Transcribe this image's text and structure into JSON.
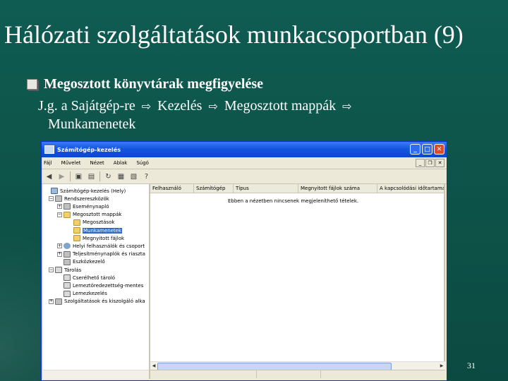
{
  "slide": {
    "title": "Hálózati szolgáltatások munkacsoportban (9)",
    "bullet": "Megosztott könyvtárak megfigyelése",
    "line1": "J.g. a Sajátgép-re",
    "path1": "Kezelés",
    "path2": "Megosztott mappák",
    "line2": "Munkamenetek",
    "arrow_glyph": "⇨",
    "page_number": "31"
  },
  "window": {
    "title": "Számítógép-kezelés",
    "menu": [
      "Fájl",
      "Művelet",
      "Nézet",
      "Ablak",
      "Súgó"
    ],
    "buttons": {
      "minimize": "_",
      "maximize": "□",
      "close": "✕"
    },
    "mdi_buttons": {
      "minimize": "_",
      "restore": "❐",
      "close": "✕"
    },
    "tree": [
      {
        "label": "Számítógép-kezelés (Hely)",
        "icon": "pc-icon",
        "exp": ""
      },
      {
        "label": "Rendszereszközök",
        "icon": "tool-icon",
        "exp": "−"
      },
      {
        "label": "Eseménynapló",
        "icon": "tool-icon",
        "exp": "+"
      },
      {
        "label": "Megosztott mappák",
        "icon": "folder-icon",
        "exp": "−"
      },
      {
        "label": "Megosztások",
        "icon": "folder-icon",
        "exp": ""
      },
      {
        "label": "Munkamenetek",
        "icon": "folder-icon",
        "exp": "",
        "selected": true
      },
      {
        "label": "Megnyitott fájlok",
        "icon": "folder-icon",
        "exp": ""
      },
      {
        "label": "Helyi felhasználók és csoport",
        "icon": "user-icon",
        "exp": "+"
      },
      {
        "label": "Teljesítménynaplók és riaszta",
        "icon": "tool-icon",
        "exp": "+"
      },
      {
        "label": "Eszközkezelő",
        "icon": "tool-icon",
        "exp": ""
      },
      {
        "label": "Tárolás",
        "icon": "disk-icon",
        "exp": "−"
      },
      {
        "label": "Cserélhető tároló",
        "icon": "disk-icon",
        "exp": ""
      },
      {
        "label": "Lemeztöredezettség-mentes",
        "icon": "disk-icon",
        "exp": ""
      },
      {
        "label": "Lemezkezelés",
        "icon": "disk-icon",
        "exp": ""
      },
      {
        "label": "Szolgáltatások és kiszolgáló alka",
        "icon": "tool-icon",
        "exp": "+"
      }
    ],
    "columns": [
      "Felhasználó",
      "Számítógép",
      "Típus",
      "Megnyitott fájlok száma",
      "A kapcsolódási időtartama"
    ],
    "empty_message": "Ebben a nézetben nincsenek megjeleníthető tételek."
  }
}
